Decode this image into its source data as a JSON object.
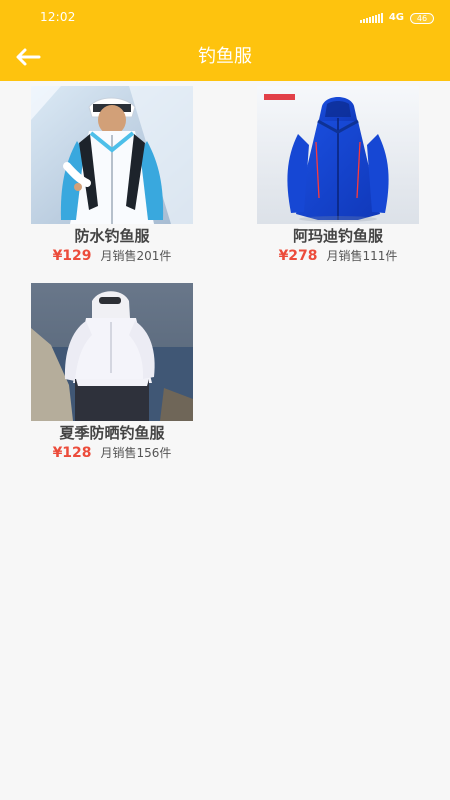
{
  "status_bar": {
    "time": "12:02",
    "network": "4G",
    "battery": "46"
  },
  "header": {
    "title": "钓鱼服",
    "back_icon": "arrow-left-icon"
  },
  "products": [
    {
      "name": "防水钓鱼服",
      "price": "¥129",
      "sales": "月销售201件"
    },
    {
      "name": "阿玛迪钓鱼服",
      "price": "¥278",
      "sales": "月销售111件"
    },
    {
      "name": "夏季防晒钓鱼服",
      "price": "¥128",
      "sales": "月销售156件"
    }
  ],
  "colors": {
    "header": "#fec30e",
    "background": "#f7f7f7",
    "price": "#ec4c3b",
    "title_text": "#ffffff"
  }
}
